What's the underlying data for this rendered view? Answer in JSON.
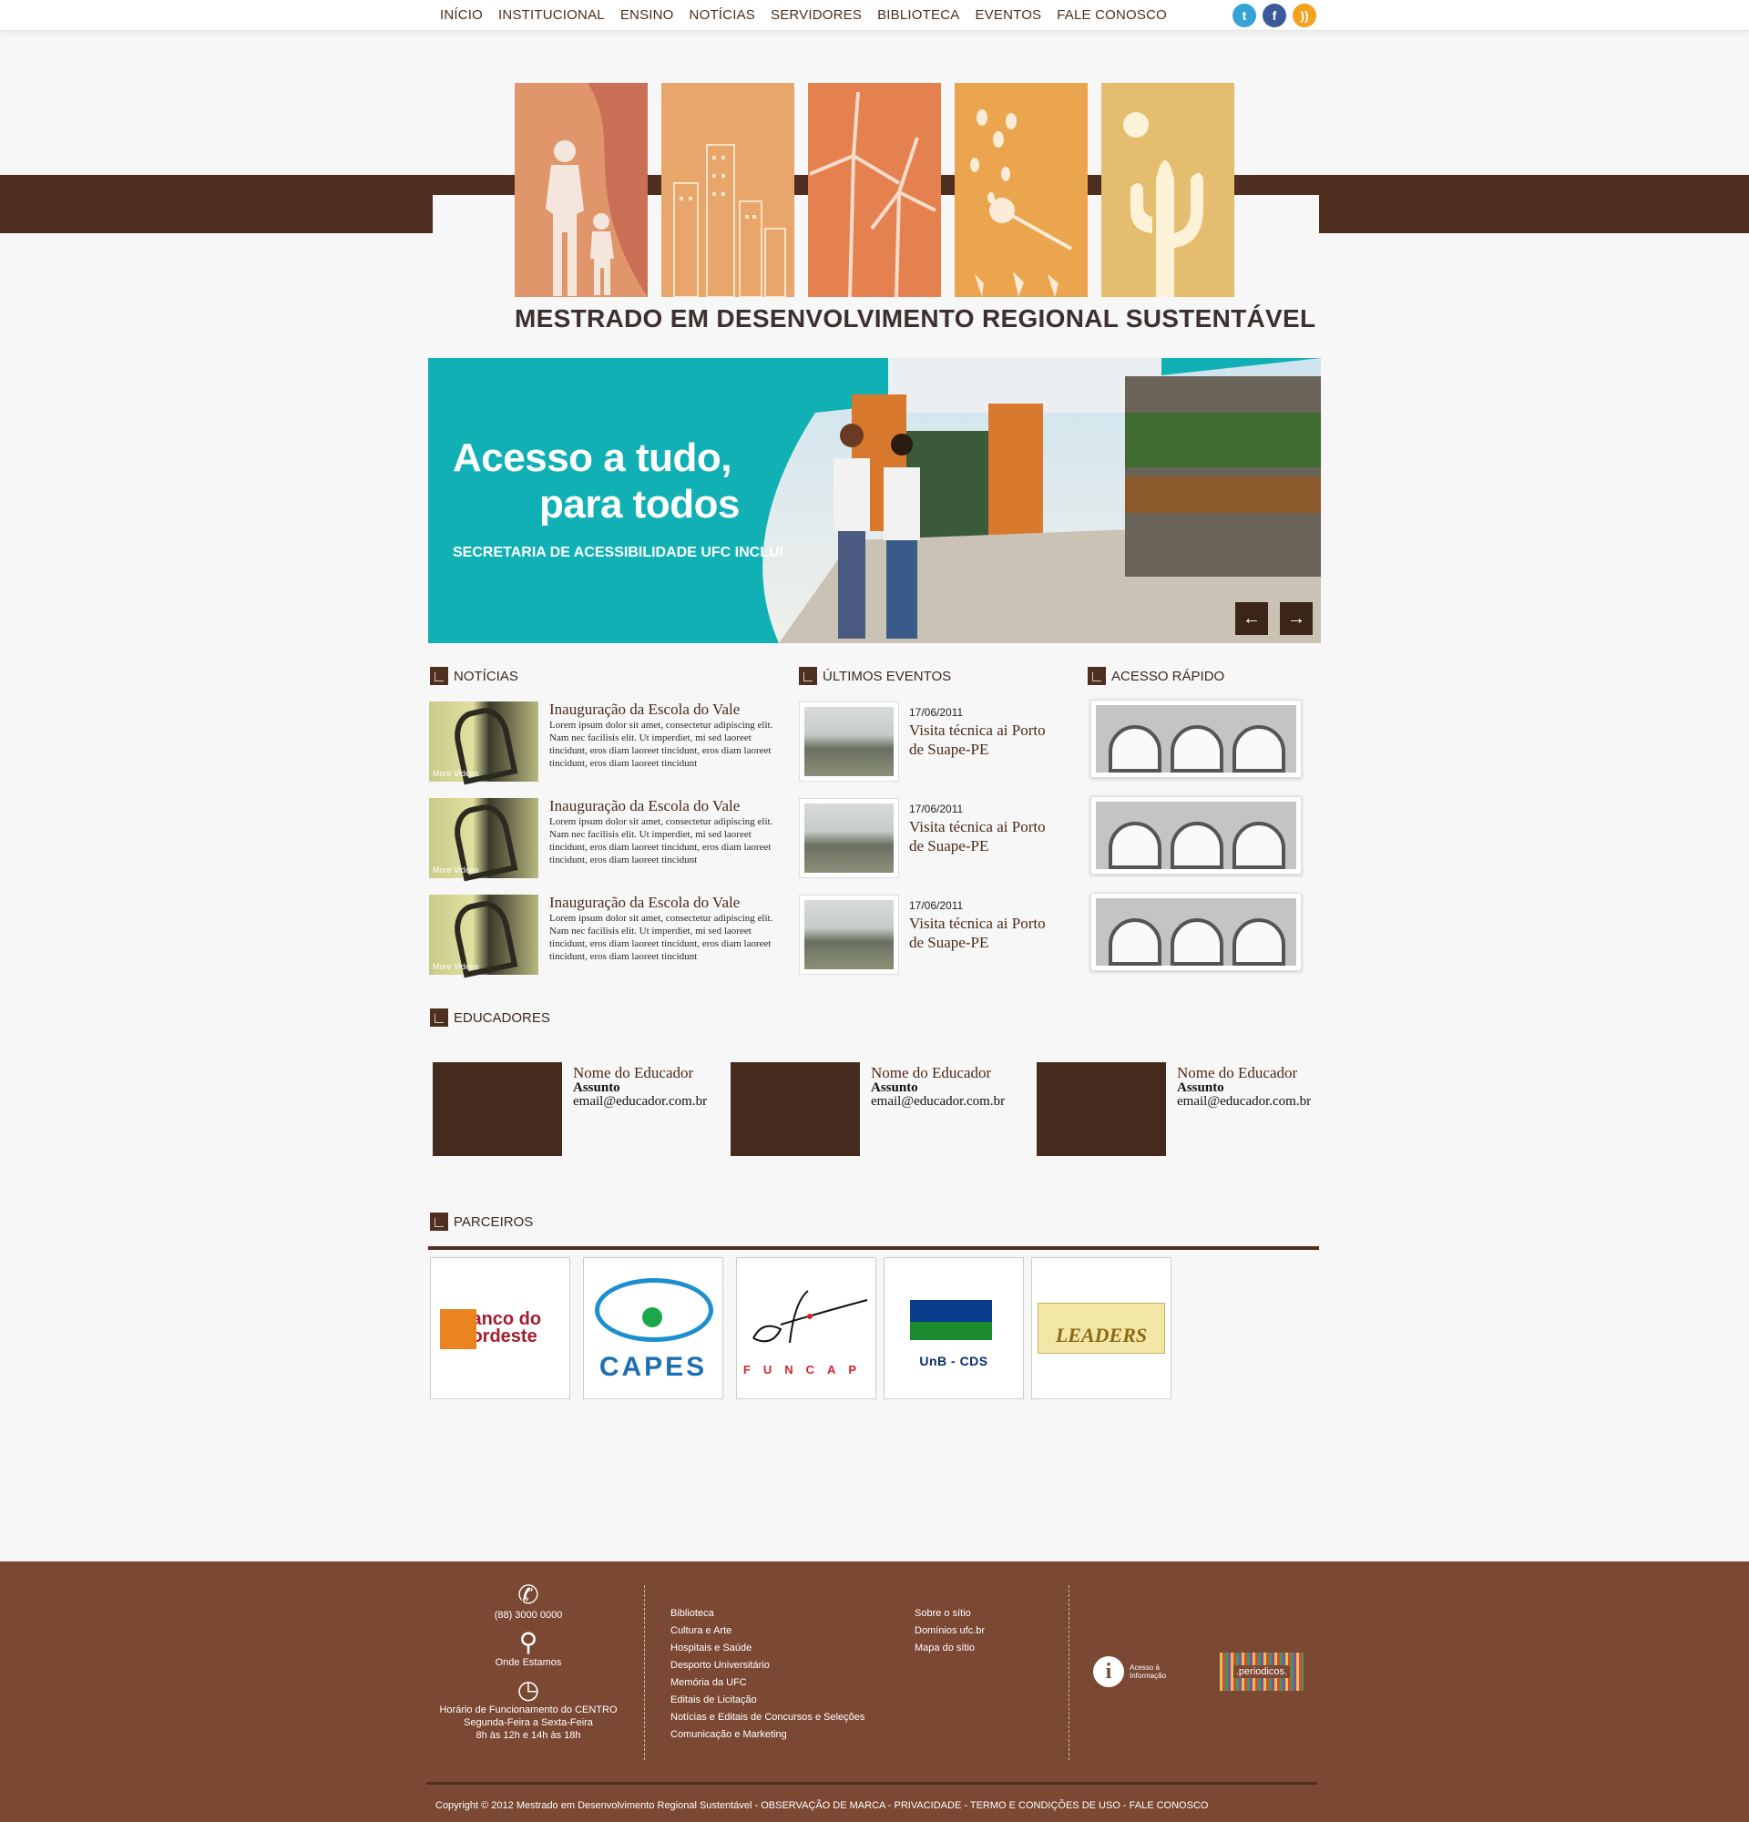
{
  "nav": {
    "items": [
      "INÍCIO",
      "INSTITUCIONAL",
      "ENSINO",
      "NOTÍCIAS",
      "SERVIDORES",
      "BIBLIOTECA",
      "EVENTOS",
      "FALE CONOSCO"
    ],
    "social": [
      "twitter-icon",
      "facebook-icon",
      "rss-icon"
    ]
  },
  "header": {
    "title": "MESTRADO EM DESENVOLVIMENTO REGIONAL SUSTENTÁVEL"
  },
  "slider": {
    "headline1": "Acesso a tudo,",
    "headline2": "para todos",
    "subtitle": "SECRETARIA DE ACESSIBILIDADE UFC INCLUI",
    "prev": "←",
    "next": "→"
  },
  "news": {
    "heading": "NOTÍCIAS",
    "items": [
      {
        "title": "Inauguração da Escola do Vale",
        "text": "Lorem ipsum dolor sit amet, consectetur adipiscing elit. Nam nec facilisis elit. Ut imperdiet, mi sed laoreet tincidunt, eros diam laoreet tincidunt, eros diam laoreet tincidunt, eros diam laoreet tincidunt",
        "thumb_label": "More Videos"
      },
      {
        "title": "Inauguração da Escola do Vale",
        "text": "Lorem ipsum dolor sit amet, consectetur adipiscing elit. Nam nec facilisis elit. Ut imperdiet, mi sed laoreet tincidunt, eros diam laoreet tincidunt, eros diam laoreet tincidunt, eros diam laoreet tincidunt",
        "thumb_label": "More Videos"
      },
      {
        "title": "Inauguração da Escola do Vale",
        "text": "Lorem ipsum dolor sit amet, consectetur adipiscing elit. Nam nec facilisis elit. Ut imperdiet, mi sed laoreet tincidunt, eros diam laoreet tincidunt, eros diam laoreet tincidunt, eros diam laoreet tincidunt",
        "thumb_label": "More Videos"
      }
    ]
  },
  "events": {
    "heading": "ÚLTIMOS EVENTOS",
    "items": [
      {
        "date": "17/06/2011",
        "title": "Visita técnica ai Porto de Suape-PE"
      },
      {
        "date": "17/06/2011",
        "title": "Visita técnica ai Porto de Suape-PE"
      },
      {
        "date": "17/06/2011",
        "title": "Visita técnica ai Porto de Suape-PE"
      }
    ]
  },
  "quick": {
    "heading": "ACESSO RÁPIDO"
  },
  "educators": {
    "heading": "EDUCADORES",
    "items": [
      {
        "name": "Nome do Educador",
        "subject": "Assunto",
        "email": "email@educador.com.br"
      },
      {
        "name": "Nome do Educador",
        "subject": "Assunto",
        "email": "email@educador.com.br"
      },
      {
        "name": "Nome do Educador",
        "subject": "Assunto",
        "email": "email@educador.com.br"
      }
    ]
  },
  "partners": {
    "heading": "PARCEIROS",
    "items": [
      "Banco do Nordeste",
      "CAPES",
      "FUNCAP",
      "UnB - CDS",
      "LEADERS"
    ]
  },
  "footer": {
    "phone": "(88) 3000 0000",
    "location": "Onde Estamos",
    "hours_title": "Horário de Funcionamento do CENTRO",
    "hours_days": "Segunda-Feira a Sexta-Feira",
    "hours_time": "8h às 12h e 14h às 18h",
    "links1": [
      "Biblioteca",
      "Cultura e Arte",
      "Hospitais e Saúde",
      "Desporto Universitário",
      "Memória da UFC",
      "Editais de Licitação",
      "Notícias e Editais de Concursos e Seleções",
      "Comunicação e Marketing"
    ],
    "links2": [
      "Sobre o sítio",
      "Domínios ufc.br",
      "Mapa do sítio"
    ],
    "acesso_line1": "Acesso à",
    "acesso_line2": "Informação",
    "periodicos": ".periodicos.",
    "copyright": "Copyright © 2012 Mestrado em Desenvolvimento Regional Sustentável - OBSERVAÇÃO DE MARCA - PRIVACIDADE - TERMO E CONDIÇÕES DE USO - FALE CONOSCO"
  },
  "colors": {
    "brand_brown": "#4e2f20",
    "footer_brown": "#7b4833",
    "slider_teal": "#11b0b4"
  }
}
